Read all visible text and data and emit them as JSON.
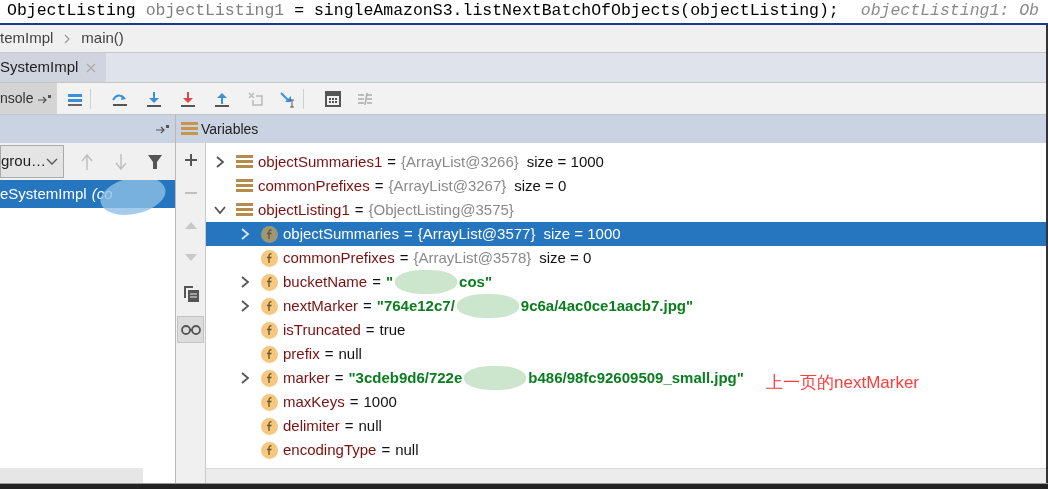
{
  "editor": {
    "code_parts": [
      {
        "text": "ObjectListing ",
        "kind": "code"
      },
      {
        "text": "objectListing1",
        "kind": "unused"
      },
      {
        "text": " = singleAmazonS3.listNextBatchOfObjects(objectListing);",
        "kind": "code"
      }
    ],
    "inline_hint": "objectListing1: Ob"
  },
  "breadcrumbs": [
    "temImpl",
    "main()"
  ],
  "tabs": [
    {
      "label": "SystemImpl",
      "selected": true
    }
  ],
  "toolbar": {
    "console_label": "nsole"
  },
  "frames_panel": {
    "thread_dropdown": "grou…",
    "frames": [
      {
        "method": "eSystemImpl",
        "detail": "(co",
        "selected": true
      }
    ]
  },
  "variables_panel": {
    "title": "Variables",
    "variables": [
      {
        "name": "objectSummaries1",
        "kind": "list",
        "expanded": false,
        "selected": false,
        "eq": "=",
        "ref": "{ArrayList@3266}",
        "extra": "size = 1000"
      },
      {
        "name": "commonPrefixes",
        "kind": "list",
        "selected": false,
        "eq": "=",
        "ref": "{ArrayList@3267}",
        "extra": "size = 0"
      },
      {
        "name": "objectListing1",
        "kind": "list",
        "expanded": true,
        "selected": false,
        "eq": "=",
        "ref": "{ObjectListing@3575}",
        "children": [
          {
            "name": "objectSummaries",
            "kind": "field",
            "expanded": false,
            "selected": true,
            "eq": "=",
            "ref": "{ArrayList@3577}",
            "extra": "size = 1000"
          },
          {
            "name": "commonPrefixes",
            "kind": "field",
            "selected": false,
            "eq": "=",
            "ref": "{ArrayList@3578}",
            "extra": "size = 0"
          },
          {
            "name": "bucketName",
            "kind": "field",
            "expanded": false,
            "selected": false,
            "eq": "=",
            "string_parts": [
              "\"",
              "cos\""
            ]
          },
          {
            "name": "nextMarker",
            "kind": "field",
            "expanded": false,
            "selected": false,
            "eq": "=",
            "string_parts": [
              "\"764e12c7/",
              "9c6a/4ac0ce1aacb7.jpg\""
            ]
          },
          {
            "name": "isTruncated",
            "kind": "field",
            "selected": false,
            "eq": "=",
            "value": "true"
          },
          {
            "name": "prefix",
            "kind": "field",
            "selected": false,
            "eq": "=",
            "value": "null"
          },
          {
            "name": "marker",
            "kind": "field",
            "expanded": false,
            "selected": false,
            "eq": "=",
            "string_parts": [
              "\"3cdeb9d6/722e",
              "b486/98fc92609509_small.jpg\""
            ]
          },
          {
            "name": "maxKeys",
            "kind": "field",
            "selected": false,
            "eq": "=",
            "value": "1000"
          },
          {
            "name": "delimiter",
            "kind": "field",
            "selected": false,
            "eq": "=",
            "value": "null"
          },
          {
            "name": "encodingType",
            "kind": "field",
            "selected": false,
            "eq": "=",
            "value": "null"
          }
        ]
      }
    ]
  },
  "annotation": "上一页的nextMarker"
}
